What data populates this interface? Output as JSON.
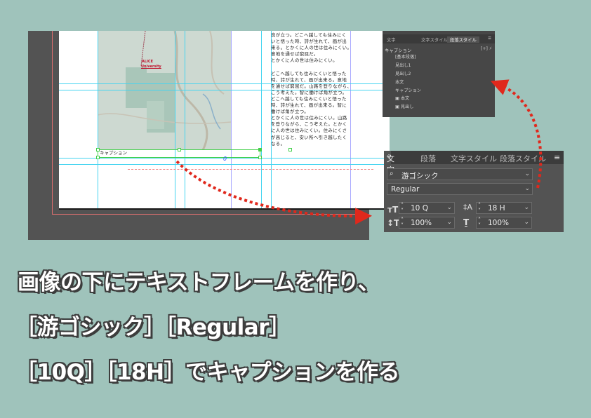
{
  "document": {
    "map_label_1": "ALICE",
    "map_label_2": "University",
    "body_lines": [
      "良が立つ。どこへ越しても住みにく",
      "いと悟った時、詩が生れて、画が出",
      "来る。とかくに人の世は住みにくい。",
      "意地を通せば窮屈だ。",
      "とかくに人の世は住みにくい。",
      "",
      "どこへ越しても住みにくいと悟った",
      "時、詩が生れて、画が出来る。意地",
      "を通せば窮屈だ。山路を登りながら、",
      "こう考えた。智に働けば角が立つ。",
      "どこへ越しても住みにくいと悟った",
      "時、詩が生れて、画が出来る。智に",
      "働けば角が立つ。",
      "とかくに人の世は住みにくい。山路",
      "を登りながら、こう考えた。とかく",
      "に人の世は住みにくい。住みにくさ",
      "が高じると、安い所へ引き越したく",
      "なる。"
    ],
    "caption_text": "キャプション",
    "frame_marker": "0"
  },
  "paragraph_styles_panel": {
    "tabs": [
      "文字",
      "文字スタイル",
      "段落スタイル"
    ],
    "active_tab": "段落スタイル",
    "current_style": "キャプション",
    "items": [
      "[基本段落]",
      "見出し1",
      "見出し2",
      "本文",
      "キャプション",
      "本文",
      "見出し"
    ]
  },
  "character_panel": {
    "tabs": [
      "文字",
      "段落",
      "文字スタイル",
      "段落スタイル"
    ],
    "active_tab": "文字",
    "menu_icon": "hamburger-menu-icon",
    "font_family": "游ゴシック",
    "font_style": "Regular",
    "font_size": "10 Q",
    "leading": "18 H",
    "vertical_scale": "100%",
    "horizontal_scale": "100%"
  },
  "heading": {
    "line1": "画像の下にテキストフレームを作り、",
    "line2": "［游ゴシック］［Regular］",
    "line3": "［10Q］［18H］でキャプションを作る"
  },
  "colors": {
    "background": "#9fc3bb",
    "pasteboard": "#535353",
    "panel": "#535353",
    "arrow": "#e0281c",
    "guide": "#44d4f0",
    "frame": "#44d04a"
  }
}
